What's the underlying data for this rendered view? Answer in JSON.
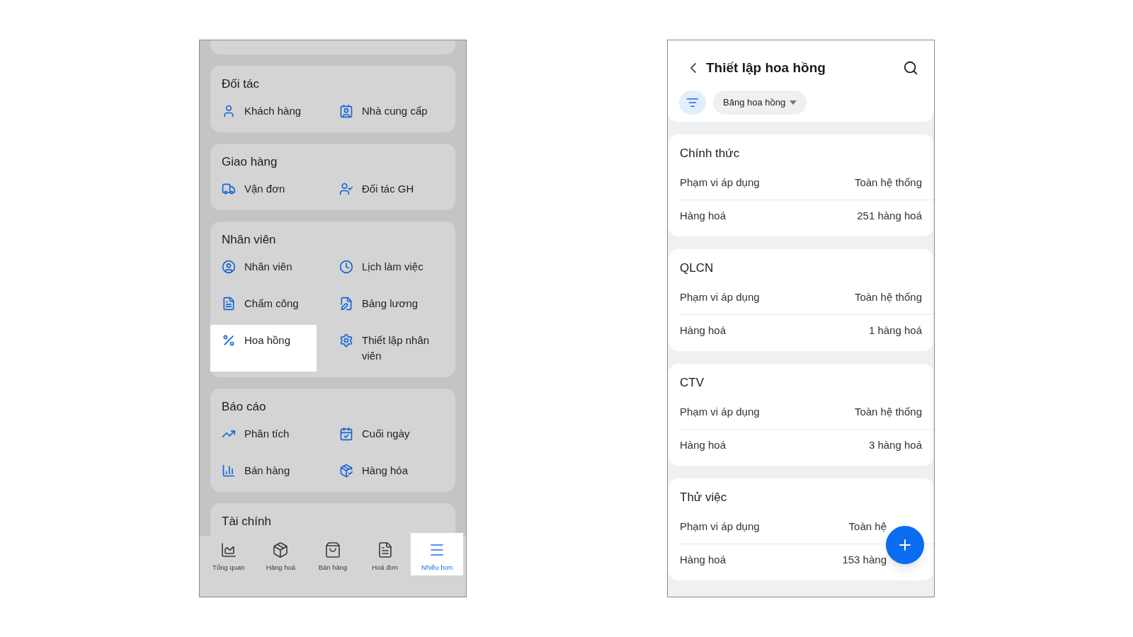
{
  "menu_screen": {
    "sections": [
      {
        "title": "Đối tác",
        "items": [
          {
            "label": "Khách hàng",
            "highlighted": false
          },
          {
            "label": "Nhà cung cấp",
            "highlighted": false
          }
        ]
      },
      {
        "title": "Giao hàng",
        "items": [
          {
            "label": "Vận đơn",
            "highlighted": false
          },
          {
            "label": "Đối tác GH",
            "highlighted": false
          }
        ]
      },
      {
        "title": "Nhân viên",
        "items": [
          {
            "label": "Nhân viên",
            "highlighted": false
          },
          {
            "label": "Lịch làm việc",
            "highlighted": false
          },
          {
            "label": "Chấm công",
            "highlighted": false
          },
          {
            "label": "Bảng lương",
            "highlighted": false
          },
          {
            "label": "Hoa hồng",
            "highlighted": true
          },
          {
            "label": "Thiết lập nhân viên",
            "highlighted": false
          }
        ]
      },
      {
        "title": "Báo cáo",
        "items": [
          {
            "label": "Phân tích",
            "highlighted": false
          },
          {
            "label": "Cuối ngày",
            "highlighted": false
          },
          {
            "label": "Bán hàng",
            "highlighted": false
          },
          {
            "label": "Hàng hóa",
            "highlighted": false
          }
        ]
      },
      {
        "title": "Tài chính"
      }
    ],
    "bottom_nav": [
      {
        "label": "Tổng quan",
        "selected": false
      },
      {
        "label": "Hàng hoá",
        "selected": false
      },
      {
        "label": "Bán hàng",
        "selected": false
      },
      {
        "label": "Hoá đơn",
        "selected": false
      },
      {
        "label": "Nhiều hơn",
        "selected": true
      }
    ]
  },
  "commission_screen": {
    "title": "Thiết lập hoa hồng",
    "filter_chip": "Bảng hoa hồng",
    "cards": [
      {
        "title": "Chính thức",
        "rows": [
          {
            "label": "Phạm vi áp dụng",
            "value": "Toàn hệ thống"
          },
          {
            "label": "Hàng hoá",
            "value": "251 hàng hoá"
          }
        ]
      },
      {
        "title": "QLCN",
        "rows": [
          {
            "label": "Phạm vi áp dụng",
            "value": "Toàn hệ thống"
          },
          {
            "label": "Hàng hoá",
            "value": "1 hàng hoá"
          }
        ]
      },
      {
        "title": "CTV",
        "rows": [
          {
            "label": "Phạm vi áp dụng",
            "value": "Toàn hệ thống"
          },
          {
            "label": "Hàng hoá",
            "value": "3 hàng hoá"
          }
        ]
      },
      {
        "title": "Thử việc",
        "rows": [
          {
            "label": "Phạm vi áp dụng",
            "value": "Toàn hệ"
          },
          {
            "label": "Hàng hoá",
            "value": "153 hàng"
          }
        ]
      }
    ]
  }
}
